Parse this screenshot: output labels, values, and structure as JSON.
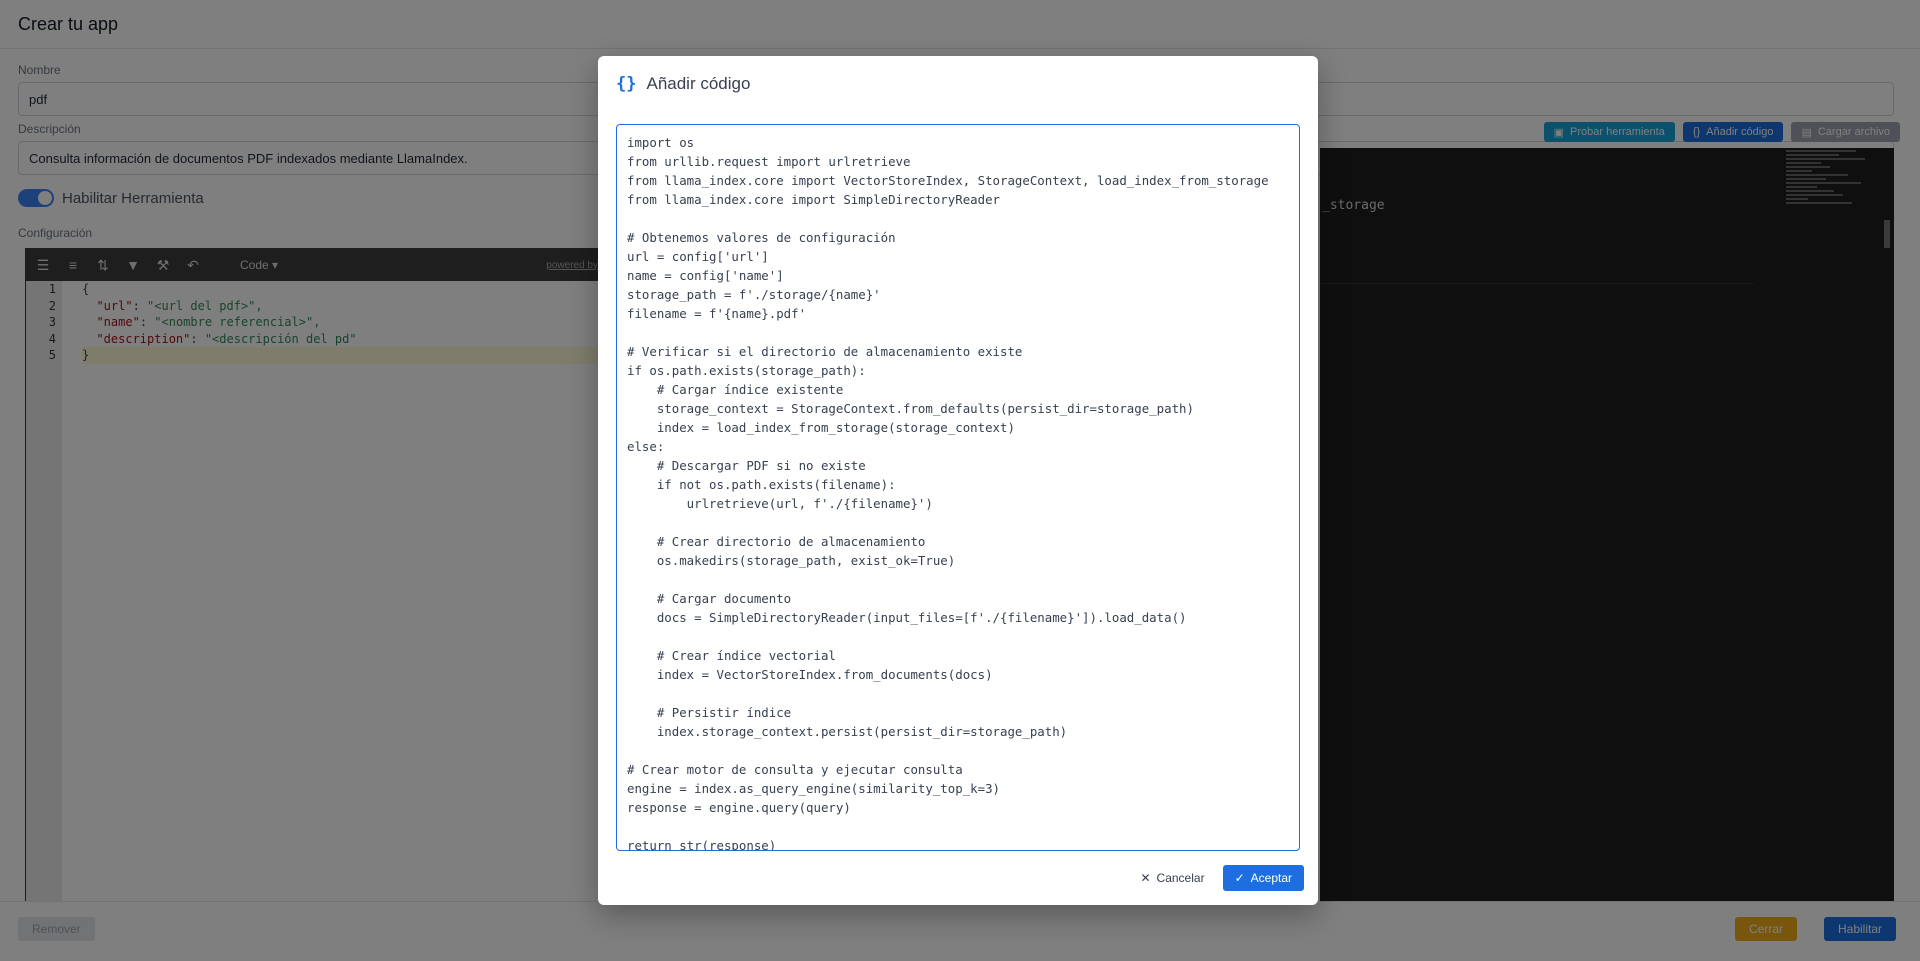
{
  "page": {
    "title": "Crear tu app",
    "name_label": "Nombre",
    "name_value": "pdf",
    "description_label": "Descripción",
    "description_value": "Consulta información de documentos PDF indexados mediante LlamaIndex.",
    "toggle_label": "Habilitar Herramienta",
    "config_label": "Configuración",
    "tool_buttons": {
      "test": "Probar herramienta",
      "add_code": "Añadir código",
      "upload": "Cargar archivo"
    },
    "json_editor": {
      "mode": "Code ▾",
      "powered": "powered by",
      "line_numbers": [
        "1",
        "2",
        "3",
        "4",
        "5"
      ],
      "lines": {
        "l1": "{",
        "l2_key": "\"url\"",
        "l2_val": "\"<url del pdf>\",",
        "l3_key": "\"name\"",
        "l3_val": "\"<nombre referencial>\",",
        "l4_key": "\"description\"",
        "l4_val": "\"<descripción del pd\"",
        "l5": "}"
      }
    },
    "code_editor_fragment": "_storage",
    "footer": {
      "remove": "Remover",
      "close": "Cerrar",
      "enable": "Habilitar"
    }
  },
  "modal": {
    "icon": "{}",
    "title": "Añadir código",
    "code": "import os\nfrom urllib.request import urlretrieve\nfrom llama_index.core import VectorStoreIndex, StorageContext, load_index_from_storage\nfrom llama_index.core import SimpleDirectoryReader\n\n# Obtenemos valores de configuración\nurl = config['url']\nname = config['name']\nstorage_path = f'./storage/{name}'\nfilename = f'{name}.pdf'\n\n# Verificar si el directorio de almacenamiento existe\nif os.path.exists(storage_path):\n    # Cargar índice existente\n    storage_context = StorageContext.from_defaults(persist_dir=storage_path)\n    index = load_index_from_storage(storage_context)\nelse:\n    # Descargar PDF si no existe\n    if not os.path.exists(filename):\n        urlretrieve(url, f'./{filename}')\n\n    # Crear directorio de almacenamiento\n    os.makedirs(storage_path, exist_ok=True)\n\n    # Cargar documento\n    docs = SimpleDirectoryReader(input_files=[f'./{filename}']).load_data()\n\n    # Crear índice vectorial\n    index = VectorStoreIndex.from_documents(docs)\n\n    # Persistir índice\n    index.storage_context.persist(persist_dir=storage_path)\n\n# Crear motor de consulta y ejecutar consulta\nengine = index.as_query_engine(similarity_top_k=3)\nresponse = engine.query(query)\n\nreturn str(response)",
    "cancel": "Cancelar",
    "accept": "Aceptar"
  }
}
